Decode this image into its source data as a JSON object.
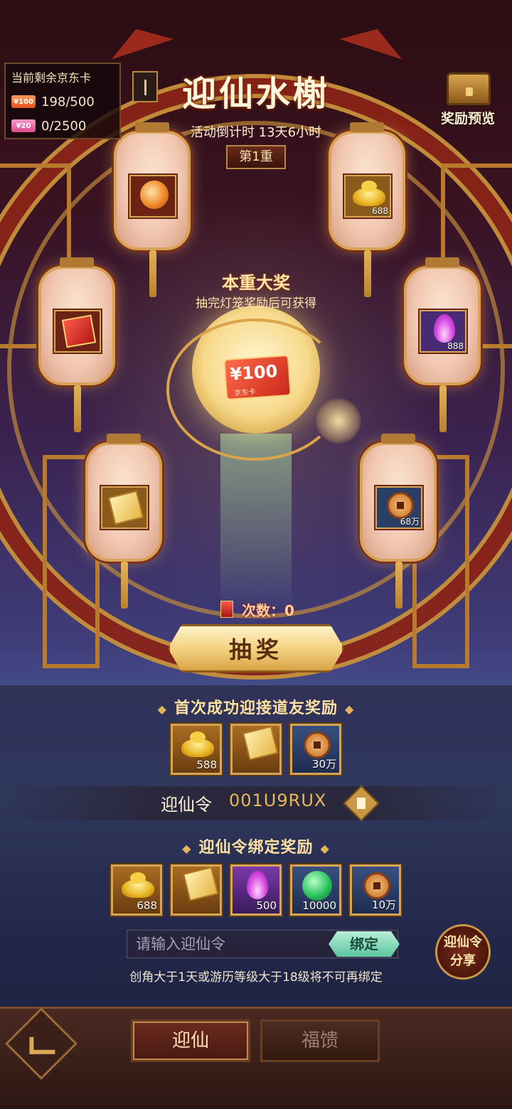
{
  "jd_card_panel": {
    "title": "当前剩余京东卡",
    "rows": [
      {
        "chip": "¥100",
        "value": "198/500"
      },
      {
        "chip": "¥20",
        "value": "0/2500"
      }
    ]
  },
  "header": {
    "title": "迎仙水榭",
    "countdown": "活动倒计时 13天6小时",
    "round": "第1重",
    "reward_preview_label": "奖励预览"
  },
  "lanterns": [
    {
      "icon": "peach-icon"
    },
    {
      "icon": "gold-ingot-icon",
      "qty": "688"
    },
    {
      "icon": "red-envelope-icon"
    },
    {
      "icon": "purple-flame-icon",
      "qty": "888"
    },
    {
      "icon": "ticket-icon"
    },
    {
      "icon": "copper-coin-icon",
      "qty": "68万"
    }
  ],
  "grand_prize": {
    "title": "本重大奖",
    "subtitle": "抽完灯笼奖励后可获得",
    "card_amount": "¥100",
    "card_label": "京东卡"
  },
  "draw": {
    "count_label": "次数：0",
    "button_label": "抽奖"
  },
  "first_success": {
    "title": "首次成功迎接道友奖励",
    "items": [
      {
        "icon": "gold-ingot-icon",
        "qty": "588"
      },
      {
        "icon": "ticket-icon",
        "qty": ""
      },
      {
        "icon": "copper-coin-icon",
        "qty": "30万"
      }
    ]
  },
  "invite_code": {
    "label": "迎仙令",
    "value": "001U9RUX"
  },
  "bind_rewards": {
    "title": "迎仙令绑定奖励",
    "items": [
      {
        "icon": "gold-ingot-icon",
        "qty": "688"
      },
      {
        "icon": "ticket-icon",
        "qty": ""
      },
      {
        "icon": "purple-flame-icon",
        "qty": "500"
      },
      {
        "icon": "green-orb-icon",
        "qty": "10000"
      },
      {
        "icon": "copper-coin-icon",
        "qty": "10万"
      }
    ]
  },
  "bind_input": {
    "placeholder": "请输入迎仙令",
    "button_label": "绑定",
    "note": "创角大于1天或游历等级大于18级将不可再绑定"
  },
  "share_badge": {
    "line1": "迎仙令",
    "line2": "分享"
  },
  "nav": {
    "tabs": [
      {
        "label": "迎仙",
        "active": true
      },
      {
        "label": "福馈",
        "active": false
      }
    ]
  }
}
